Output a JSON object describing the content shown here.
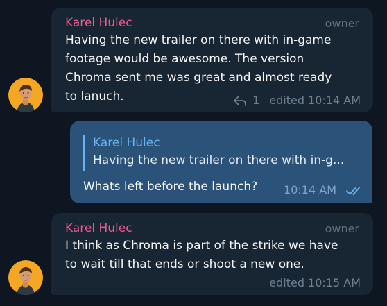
{
  "chat": {
    "messages": [
      {
        "sender": "Karel Hulec",
        "role": "owner",
        "lines": [
          "Having the new trailer on there with in-game",
          "footage would be awesome. The version",
          "Chroma sent me was great and almost ready",
          "to lanuch."
        ],
        "reply_count": "1",
        "time": "edited 10:14 AM"
      },
      {
        "reply_to": {
          "sender": "Karel Hulec",
          "preview": "Having the new trailer on there with in-g..."
        },
        "text": "Whats left before the launch?",
        "time": "10:14 AM"
      },
      {
        "sender": "Karel Hulec",
        "role": "owner",
        "lines": [
          "I think as Chroma is part of the strike we have",
          "to wait till that ends or shoot a new one."
        ],
        "time": "edited 10:15 AM"
      }
    ]
  },
  "colors": {
    "background": "#0e1621",
    "incoming_bubble": "#182533",
    "outgoing_bubble": "#2b5278",
    "sender_name": "#ee5a8f",
    "quote_accent": "#6ab3f3",
    "avatar_bg": "#f5a623"
  },
  "icons": {
    "avatar": "user-avatar-icon",
    "reply": "reply-arrow-icon",
    "read": "double-check-icon"
  }
}
